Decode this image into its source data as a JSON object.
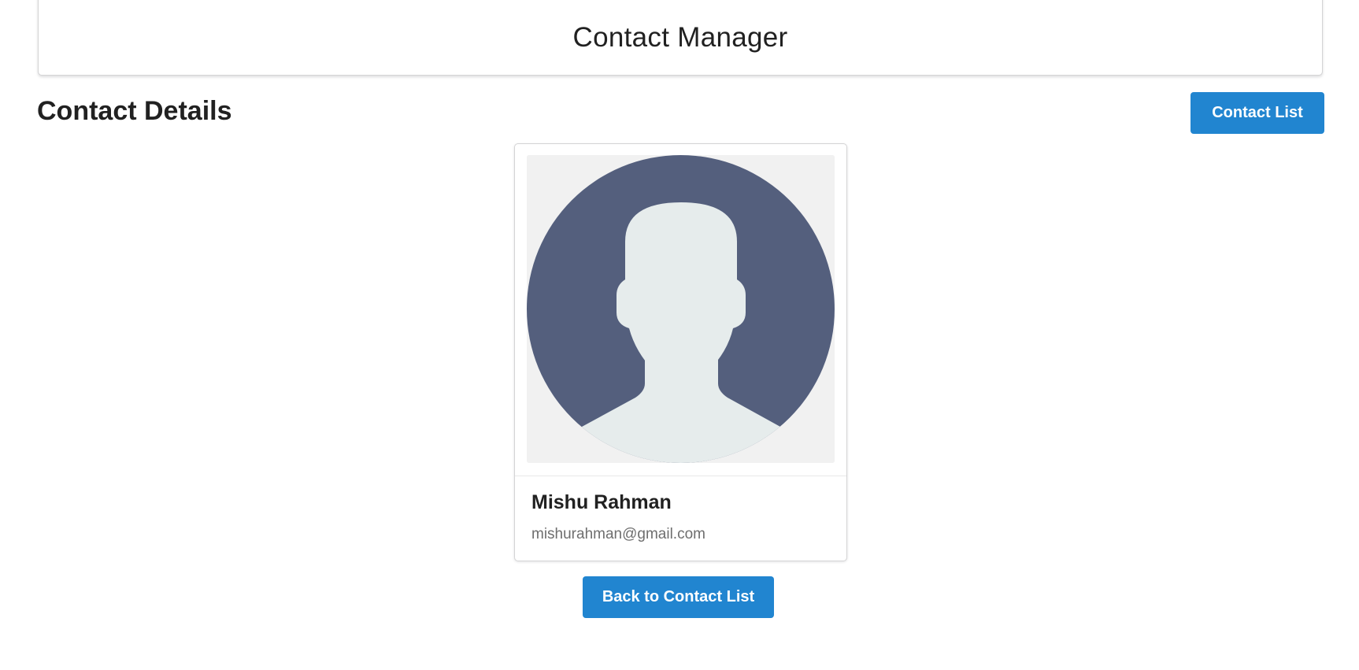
{
  "header": {
    "title": "Contact Manager"
  },
  "page": {
    "section_title": "Contact Details",
    "contact_list_button": "Contact List",
    "back_button": "Back to Contact List"
  },
  "contact": {
    "name": "Mishu Rahman",
    "email": "mishurahman@gmail.com",
    "avatar_icon": "user-avatar-icon"
  },
  "colors": {
    "primary_button": "#2185d0",
    "avatar_circle": "#545f7d",
    "avatar_silhouette": "#e6ecec",
    "avatar_background": "#f1f1f1"
  }
}
